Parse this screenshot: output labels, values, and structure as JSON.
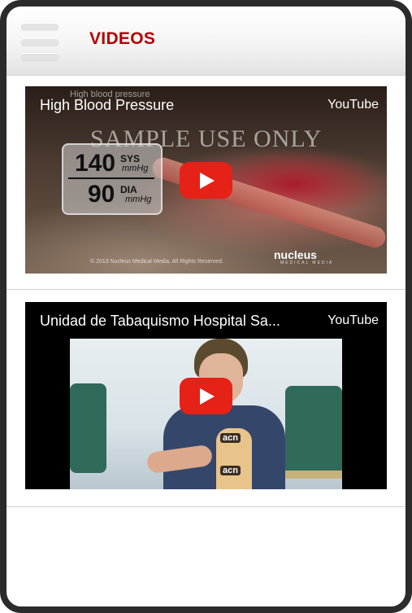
{
  "header": {
    "title": "VIDEOS",
    "menu_icon": "hamburger-menu-icon"
  },
  "videos": [
    {
      "title": "High Blood Pressure",
      "source": "YouTube",
      "overlay": {
        "top_caption": "High blood pressure",
        "watermark": "SAMPLE USE ONLY",
        "systolic": "140",
        "systolic_label": "SYS",
        "diastolic": "90",
        "diastolic_label": "DIA",
        "unit": "mmHg",
        "copyright": "© 2013 Nucleus Medical Media. All Rights Reserved.",
        "brand": "nucleus",
        "brand_sub": "MEDICAL MEDIA"
      }
    },
    {
      "title": "Unidad de Tabaquismo Hospital Sa...",
      "source": "YouTube",
      "overlay": {
        "mic_label_1": "acn",
        "mic_label_2": "acn"
      }
    }
  ],
  "colors": {
    "title_red": "#b30000",
    "play_red": "#e62117"
  }
}
